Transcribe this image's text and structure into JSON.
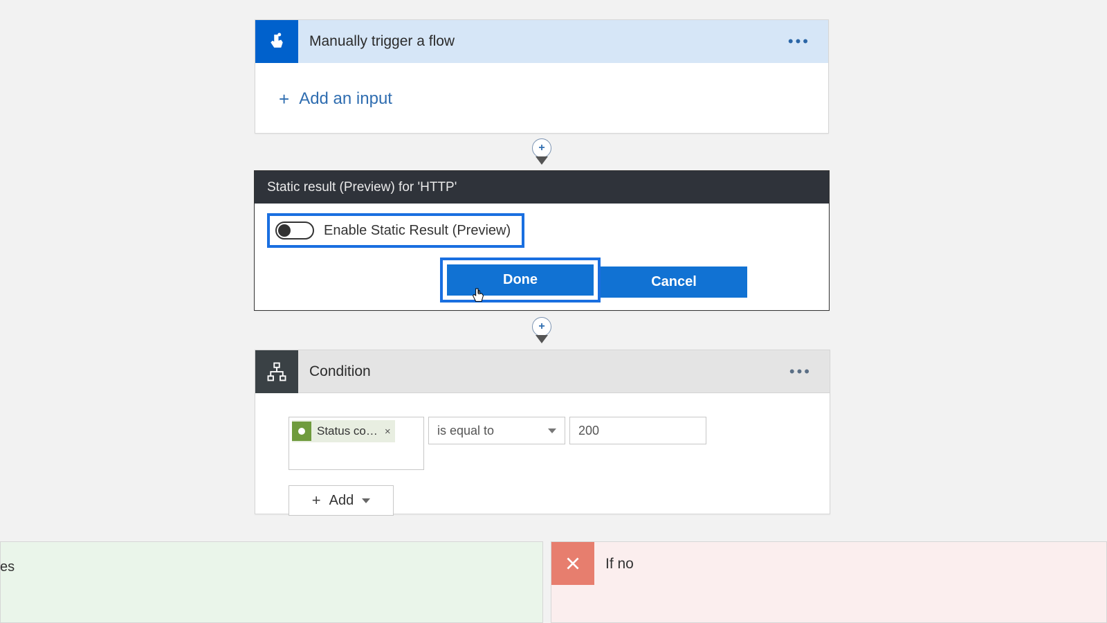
{
  "trigger": {
    "title": "Manually trigger a flow",
    "add_input_label": "Add an input"
  },
  "static_result": {
    "header": "Static result (Preview) for 'HTTP'",
    "toggle_label": "Enable Static Result (Preview)",
    "done_label": "Done",
    "cancel_label": "Cancel"
  },
  "condition": {
    "title": "Condition",
    "operand_token": "Status co…",
    "operator_label": "is equal to",
    "value": "200",
    "add_label": "Add"
  },
  "branches": {
    "yes_partial": "es",
    "no_label": "If no"
  }
}
